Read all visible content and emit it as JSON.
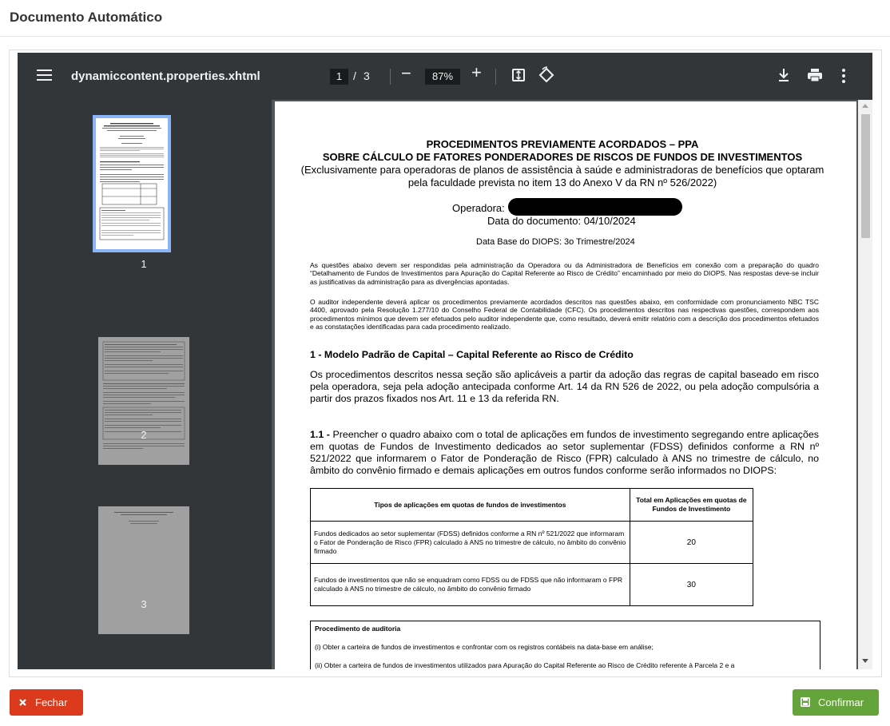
{
  "page": {
    "title": "Documento Automático"
  },
  "viewer": {
    "filename": "dynamiccontent.properties.xhtml",
    "current_page": "1",
    "page_separator": "/",
    "total_pages": "3",
    "zoom": "87%",
    "thumbnails": [
      {
        "label": "1"
      },
      {
        "label": "2"
      },
      {
        "label": "3"
      }
    ]
  },
  "document": {
    "title_line1": "PROCEDIMENTOS PREVIAMENTE ACORDADOS – PPA",
    "title_line2": "SOBRE CÁLCULO DE FATORES PONDERADORES DE RISCOS DE FUNDOS DE INVESTIMENTOS",
    "subtitle": "(Exclusivamente para operadoras de planos de assistência à saúde e administradoras de benefícios que optaram pela faculdade prevista no item 13 do Anexo V da RN nº 526/2022)",
    "operadora_label": "Operadora:",
    "data_documento": "Data do documento: 04/10/2024",
    "data_base": "Data Base do DIOPS: 3o Trimestre/2024",
    "para1": "As questões abaixo devem ser respondidas pela administração da Operadora ou da Administradora de Benefícios em conexão com a preparação do quadro “Detalhamento de Fundos de Investimentos para Apuração do Capital Referente ao Risco de Crédito” encaminhado por meio do DIOPS. Nas respostas deve-se incluir as justificativas da administração para as divergências apontadas.",
    "para2": "O auditor independente deverá aplicar os procedimentos previamente acordados descritos nas questões abaixo, em conformidade com pronunciamento NBC TSC 4400, aprovado pela Resolução 1.277/10 do Conselho Federal de Contabilidade (CFC). Os procedimentos descritos nas respectivas questões, correspondem aos procedimentos mínimos que devem ser efetuados pelo auditor independente que, como resultado, deverá emitir relatório com a descrição dos procedimentos efetuados e as constatações identificadas para cada procedimento realizado.",
    "section1_title": "1 - Modelo Padrão de Capital – Capital Referente ao Risco de Crédito",
    "section1_text": "Os procedimentos descritos nessa seção são aplicáveis a partir da adoção das regras de capital baseado em risco pela operadora, seja pela adoção antecipada conforme Art. 14 da RN 526 de 2022, ou pela adoção compulsória a partir dos prazos fixados nos Art. 11 e 13 da referida RN.",
    "item11_num": "1.1 -",
    "item11_text": "Preencher o quadro abaixo com o total de aplicações em fundos de investimento segregando entre aplicações em quotas de Fundos de Investimento dedicados ao setor suplementar (FDSS) definidos conforme a RN nº 521/2022 que informarem o Fator de Ponderação de Risco (FPR) calculado à ANS no trimestre de cálculo, no âmbito do convênio firmado e demais aplicações em outros fundos conforme serão informados no DIOPS:",
    "table": {
      "header_col1": "Tipos de aplicações em quotas de fundos de investimentos",
      "header_col2": "Total em Aplicações em quotas de Fundos de Investimento",
      "rows": [
        {
          "desc": "Fundos dedicados ao setor suplementar (FDSS) definidos conforme a RN nº 521/2022 que informaram o Fator de Ponderação de Risco (FPR) calculado à ANS no trimestre de cálculo, no âmbito do convênio firmado",
          "value": "20"
        },
        {
          "desc": "Fundos de investimentos que não se enquadram como FDSS ou de FDSS que não informaram o FPR calculado à ANS no trimestre de cálculo, no âmbito do convênio firmado",
          "value": "30"
        }
      ]
    },
    "procedure_title": "Procedimento de auditoria",
    "procedure_i": "(i) Obter a carteira de fundos de investimentos e confrontar com os registros contábeis na data-base em análise;",
    "procedure_ii": "(ii) Obter a carteira de fundos de investimentos utilizados para Apuração do Capital Referente ao Risco de Crédito referente à Parcela 2 e a"
  },
  "buttons": {
    "close": "Fechar",
    "confirm": "Confirmar"
  },
  "colors": {
    "close_button": "#db3a1d",
    "confirm_button": "#65a43a",
    "toolbar": "#323639",
    "viewer_bg": "#525659",
    "thumb_selected": "#8ab4f8"
  }
}
